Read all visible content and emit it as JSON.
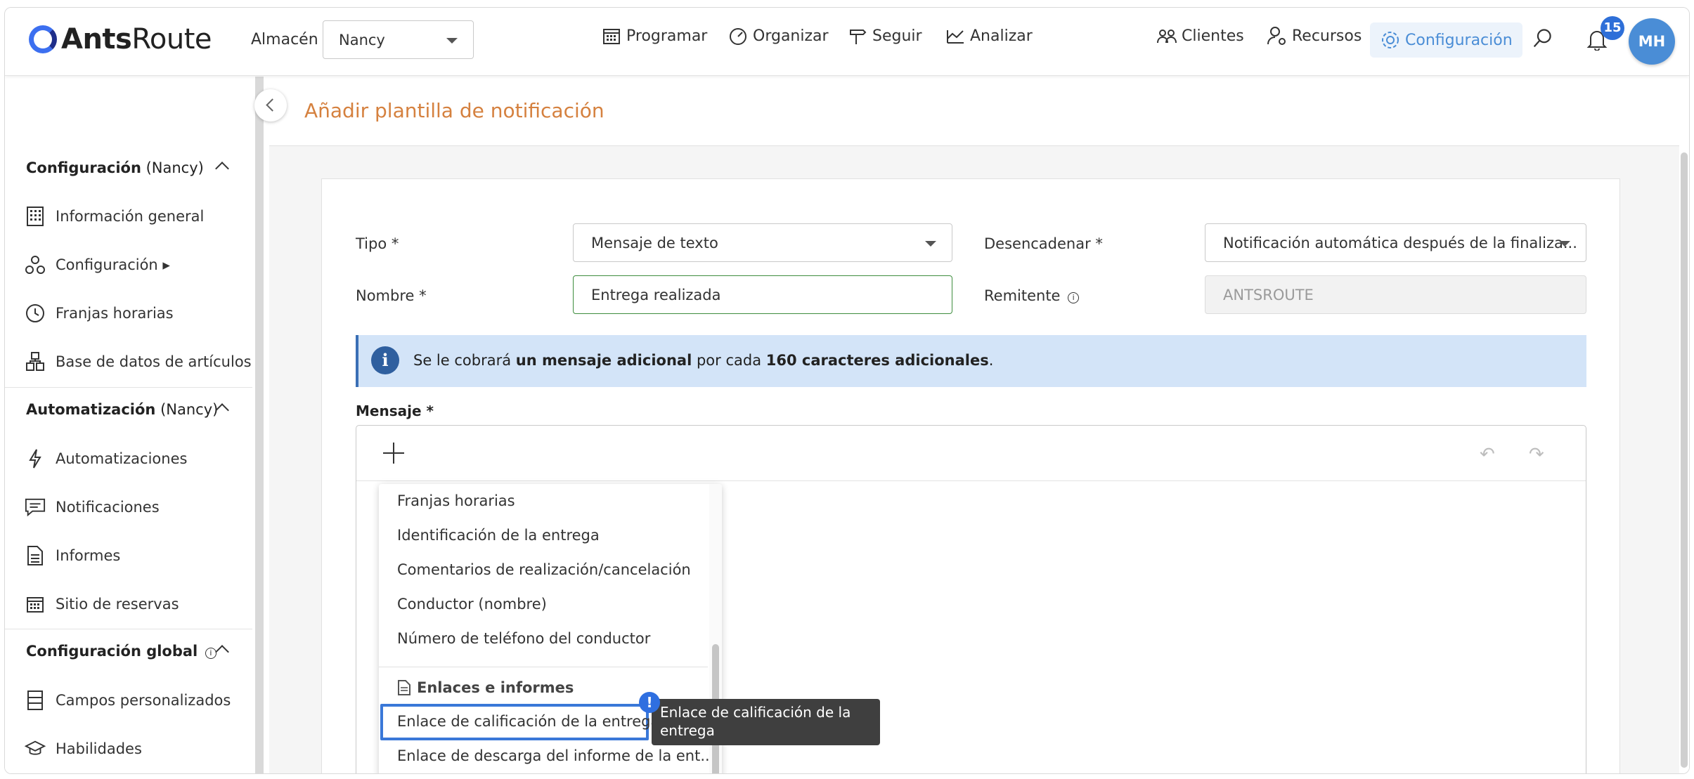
{
  "app": {
    "logo_text_bold": "Ants",
    "logo_text_light": "Route"
  },
  "header": {
    "warehouse_label": "Almacén",
    "warehouse_value": "Nancy",
    "nav": [
      {
        "label": "Programar",
        "icon": "calendar-icon"
      },
      {
        "label": "Organizar",
        "icon": "speedometer-icon"
      },
      {
        "label": "Seguir",
        "icon": "signpost-icon"
      },
      {
        "label": "Analizar",
        "icon": "chart-icon"
      }
    ],
    "right_nav": [
      {
        "label": "Clientes",
        "icon": "people-icon"
      },
      {
        "label": "Recursos",
        "icon": "user-gear-icon"
      },
      {
        "label": "Configuración",
        "icon": "gear-icon",
        "active": true
      }
    ],
    "notifications_count": "15",
    "avatar_initials": "MH"
  },
  "sidebar": {
    "section1": {
      "title_bold": "Configuración",
      "title_suffix": " (Nancy)"
    },
    "section1_items": [
      "Información general",
      "Configuración ▸",
      "Franjas horarias",
      "Base de datos de artículos"
    ],
    "section2": {
      "title_bold": "Automatización",
      "title_suffix": " (Nancy)"
    },
    "section2_items": [
      "Automatizaciones",
      "Notificaciones",
      "Informes",
      "Sitio de reservas"
    ],
    "section3": {
      "title_bold": "Configuración global"
    },
    "section3_items": [
      "Campos personalizados",
      "Habilidades"
    ]
  },
  "page": {
    "title": "Añadir plantilla de notificación",
    "tipo_label": "Tipo *",
    "tipo_value": "Mensaje de texto",
    "desencadenar_label": "Desencadenar *",
    "desencadenar_value": "Notificación automática después de la finaliza...",
    "nombre_label": "Nombre *",
    "nombre_value": "Entrega realizada",
    "remitente_label": "Remitente",
    "remitente_value": "ANTSROUTE",
    "info_text_1": "Se le cobrará ",
    "info_text_bold_1": "un mensaje adicional",
    "info_text_2": " por cada ",
    "info_text_bold_2": "160 caracteres adicionales",
    "info_text_3": ".",
    "mensaje_label": "Mensaje *"
  },
  "dropdown": {
    "items": [
      "Franjas horarias",
      "Identificación de la entrega",
      "Comentarios de realización/cancelación",
      "Conductor (nombre)",
      "Número de teléfono del conductor"
    ],
    "group_label": "Enlaces e informes",
    "group_items": [
      "Enlace de calificación de la entrega",
      "Enlace de descarga del informe de la ent..."
    ],
    "warning_glyph": "!",
    "tooltip": "Enlace de calificación de la entrega"
  },
  "colors": {
    "accent": "#4a8dd6",
    "title": "#d5813f",
    "highlight": "#3a78d8",
    "info_bg": "#d3e4f8"
  }
}
